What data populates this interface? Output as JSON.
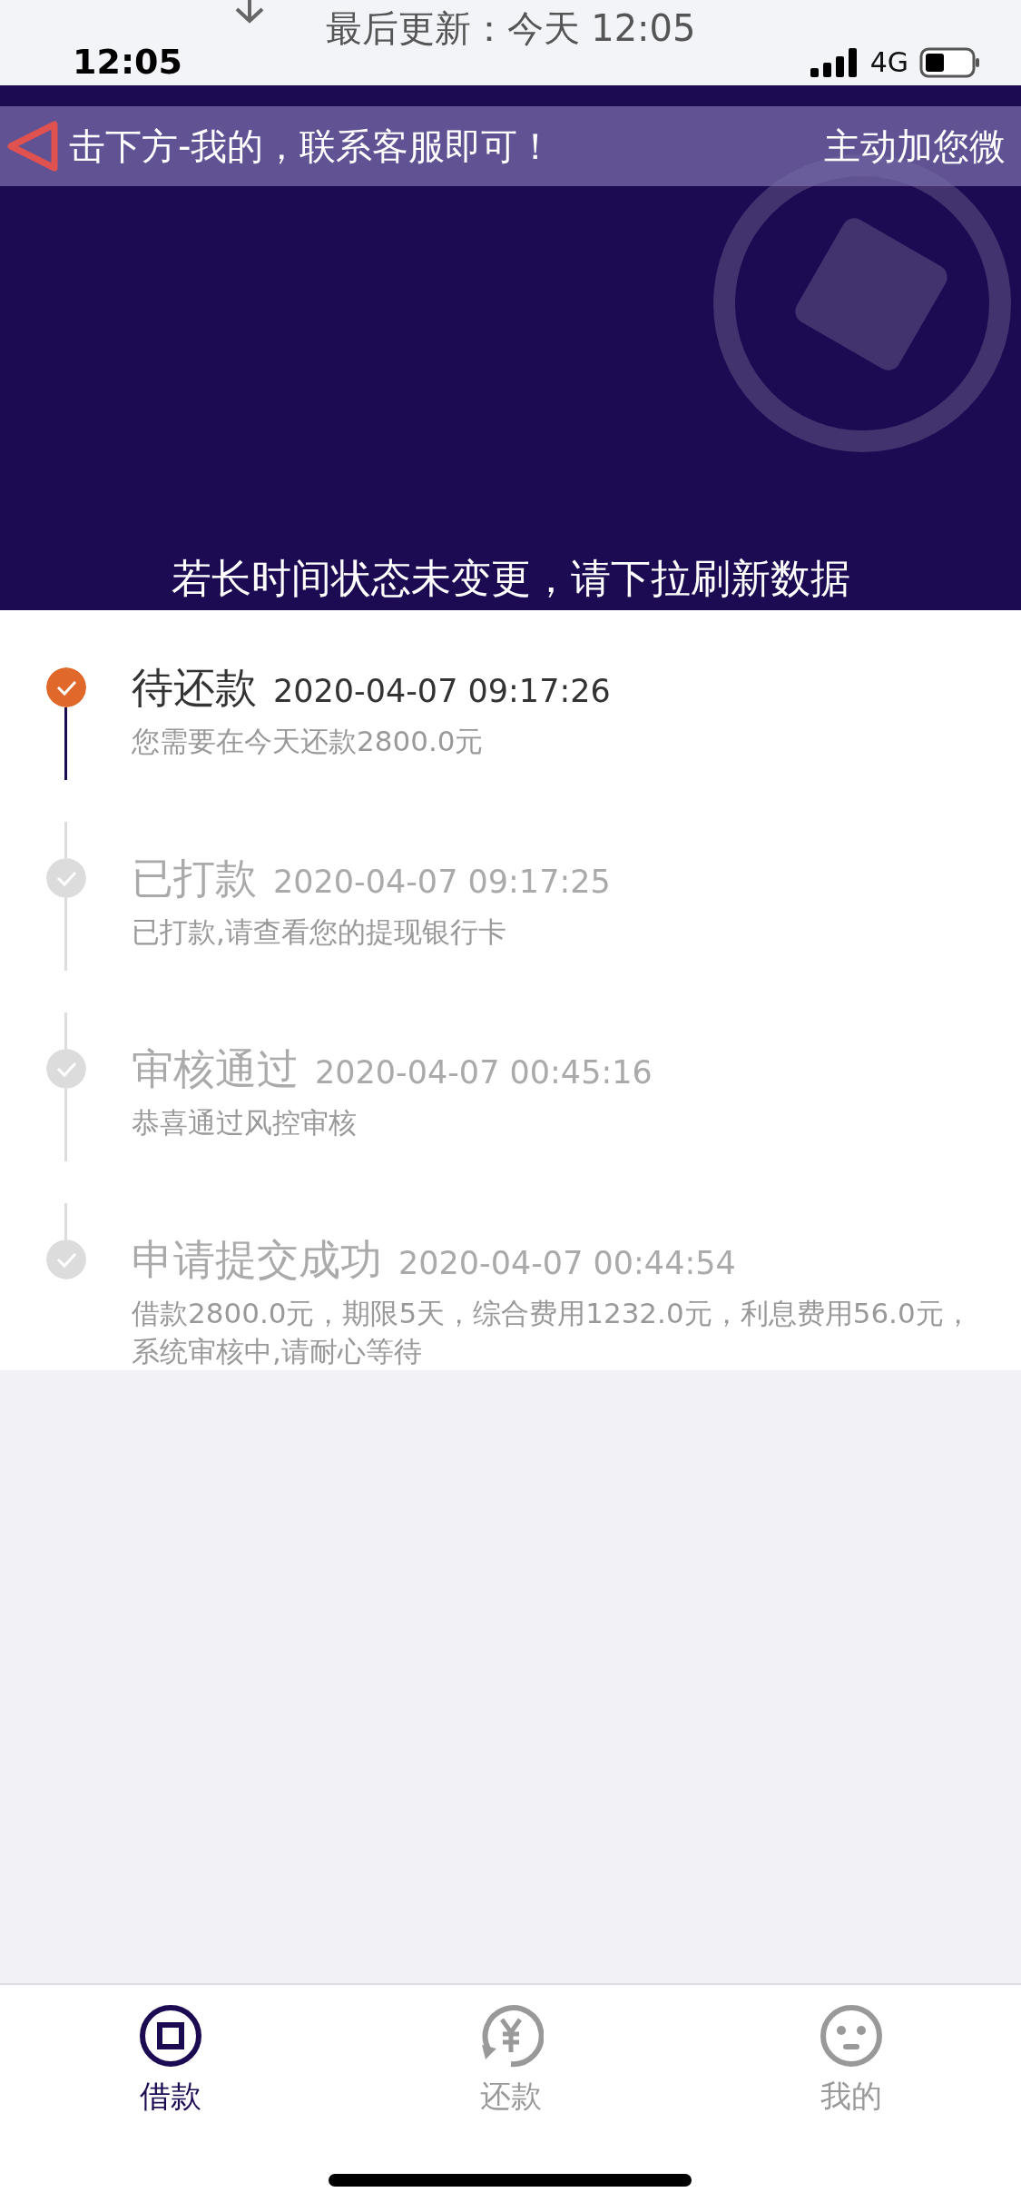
{
  "refresh_header": {
    "text": "最后更新：今天 12:05"
  },
  "status_bar": {
    "time": "12:05",
    "network": "4G"
  },
  "banner": {
    "marquee": [
      "击下方-我的，联系客服即可！",
      "主动加您微"
    ],
    "hint": "若长时间状态未变更，请下拉刷新数据"
  },
  "timeline": [
    {
      "title": "待还款",
      "time": "2020-04-07 09:17:26",
      "desc": "您需要在今天还款2800.0元",
      "active": true
    },
    {
      "title": "已打款",
      "time": "2020-04-07 09:17:25",
      "desc": "已打款,请查看您的提现银行卡",
      "active": false
    },
    {
      "title": "审核通过",
      "time": "2020-04-07 00:45:16",
      "desc": "恭喜通过风控审核",
      "active": false
    },
    {
      "title": "申请提交成功",
      "time": "2020-04-07 00:44:54",
      "desc": "借款2800.0元，期限5天，综合费用1232.0元，利息费用56.0元，系统审核中,请耐心等待",
      "active": false
    }
  ],
  "tabs": [
    {
      "label": "借款",
      "kind": "loan",
      "selected": true
    },
    {
      "label": "还款",
      "kind": "repay",
      "selected": false
    },
    {
      "label": "我的",
      "kind": "me",
      "selected": false
    }
  ]
}
